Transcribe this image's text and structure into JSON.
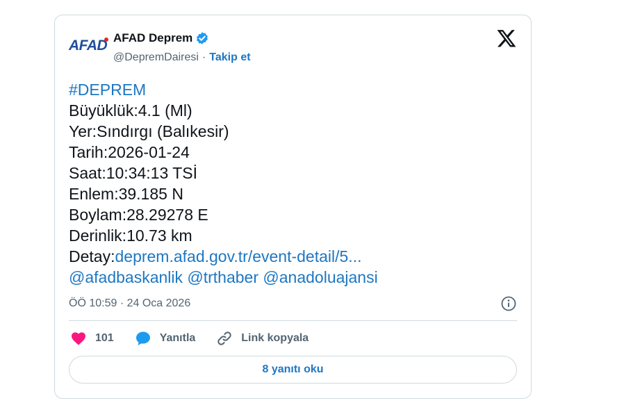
{
  "tweet": {
    "logo_text": "AFAD",
    "author_name": "AFAD Deprem",
    "handle": "@DepremDairesi",
    "separator": "·",
    "follow_label": "Takip et",
    "hashtag": "#DEPREM",
    "lines": [
      "Büyüklük:4.1 (Ml)",
      "Yer:Sındırgı (Balıkesir)",
      "Tarih:2026-01-24",
      "Saat:10:34:13 TSİ",
      "Enlem:39.185 N",
      "Boylam:28.29278 E",
      "Derinlik:10.73 km"
    ],
    "detail_prefix": "Detay:",
    "detail_link": "deprem.afad.gov.tr/event-detail/5...",
    "mentions": [
      "@afadbaskanlik",
      "@trthaber",
      "@anadoluajansi"
    ],
    "timestamp": "ÖÖ 10:59 · 24 Oca 2026",
    "like_count": "101",
    "reply_label": "Yanıtla",
    "copy_link_label": "Link kopyala",
    "read_replies_label": "8 yanıtı oku"
  },
  "colors": {
    "link": "#1d77c2",
    "like": "#f91880",
    "verified": "#1d9bf0",
    "border": "#cfd9de",
    "muted": "#536471"
  },
  "icons": [
    "verified-badge-icon",
    "x-logo-icon",
    "info-icon",
    "heart-icon",
    "reply-bubble-icon",
    "link-icon"
  ]
}
